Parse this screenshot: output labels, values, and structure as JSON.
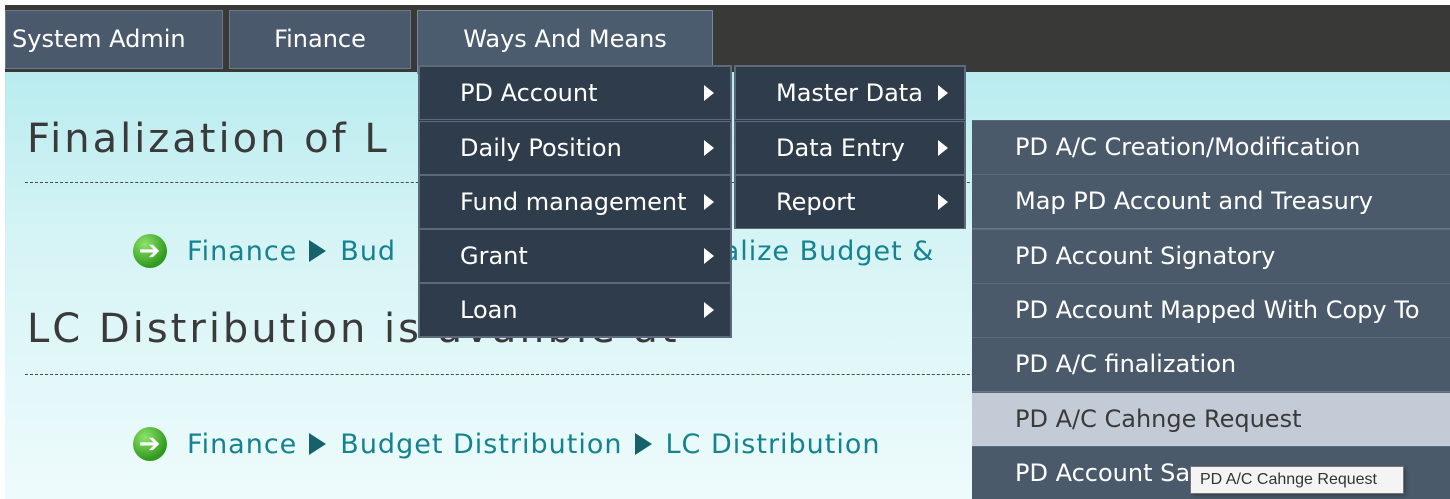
{
  "menubar": {
    "items": [
      {
        "label": "System Admin"
      },
      {
        "label": "Finance"
      },
      {
        "label": "Ways And Means"
      }
    ]
  },
  "content": {
    "heading1": "Finalization of L",
    "crumb1": [
      "Finance",
      "Bud",
      "inalize Budget &"
    ],
    "heading2": "LC Distribution is availble at",
    "crumb2": [
      "Finance",
      "Budget Distribution",
      "LC Distribution"
    ],
    "heading3": "..."
  },
  "dropdown_l1": {
    "items": [
      {
        "label": "PD Account"
      },
      {
        "label": "Daily Position"
      },
      {
        "label": "Fund management"
      },
      {
        "label": "Grant"
      },
      {
        "label": "Loan"
      }
    ]
  },
  "dropdown_l2": {
    "items": [
      {
        "label": "Master Data"
      },
      {
        "label": "Data Entry"
      },
      {
        "label": "Report"
      }
    ]
  },
  "dropdown_l3": {
    "items": [
      {
        "label": "PD A/C Creation/Modification"
      },
      {
        "label": "Map PD Account and Treasury"
      },
      {
        "label": "PD Account Signatory"
      },
      {
        "label": "PD Account Mapped With Copy To"
      },
      {
        "label": "PD A/C finalization"
      },
      {
        "label": "PD A/C Cahnge Request"
      },
      {
        "label": "PD Account Sa"
      }
    ]
  },
  "tooltip": "PD A/C Cahnge Request",
  "colors": {
    "menubar_bg": "#393937",
    "menu_item_bg": "#2f3c4c",
    "submenu_bg": "#4a5a6b",
    "hover_bg": "#c3ccd6",
    "link": "#14838f"
  }
}
